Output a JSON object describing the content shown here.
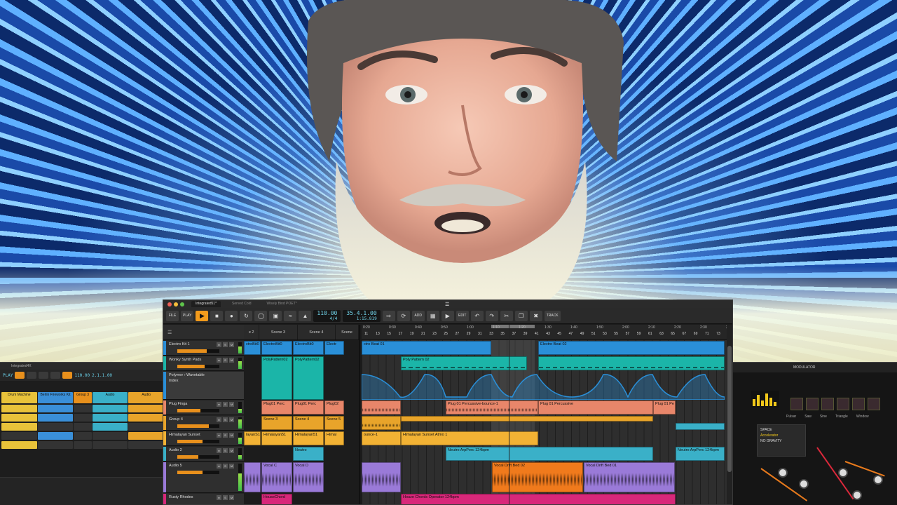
{
  "main_window": {
    "tabs": [
      "Integrated51*",
      "Served Cold",
      "Wisely Bind POET*"
    ],
    "transport": {
      "file_label": "FILE",
      "play_label": "PLAY",
      "tempo": "110.00",
      "time_sig": "4/4",
      "position": "35.4.1.00",
      "time": "1:15.819",
      "add_label": "ADD",
      "edit_label": "EDIT",
      "track_label": "TRACK"
    },
    "scenes": [
      "e 2",
      "Scene 3",
      "Scene 4",
      "Scene"
    ],
    "ruler_times": [
      "0:20",
      "0:30",
      "0:40",
      "0:50",
      "1:00",
      "1:10",
      "1:20",
      "1:30",
      "1:40",
      "1:50",
      "2:00",
      "2:10",
      "2:20",
      "2:30",
      "2:40"
    ],
    "ruler_bars": [
      "11",
      "13",
      "15",
      "17",
      "19",
      "21",
      "23",
      "25",
      "27",
      "29",
      "31",
      "33",
      "35",
      "37",
      "39",
      "41",
      "43",
      "45",
      "47",
      "49",
      "51",
      "53",
      "55",
      "57",
      "59",
      "61",
      "63",
      "65",
      "67",
      "69",
      "71",
      "73"
    ],
    "tracks": [
      {
        "name": "Electro Kit 1",
        "color": "#2a8fd8"
      },
      {
        "name": "Wonky Synth Pads",
        "color": "#1bb5a8"
      },
      {
        "name": "Polymer › Wavetable",
        "sub": "Index",
        "color": "#2a8fd8"
      },
      {
        "name": "Plug Finga",
        "color": "#e8866a"
      },
      {
        "name": "Group 4",
        "color": "#e8a42a"
      },
      {
        "name": "Himalayan Sunset",
        "color": "#f2b234"
      },
      {
        "name": "Audio 2",
        "color": "#3ab0c8"
      },
      {
        "name": "Audio 5",
        "color": "#9a7ad8"
      },
      {
        "name": "Rusty Rhodes",
        "color": "#d8287a"
      }
    ],
    "clip_launcher": {
      "row0": [
        "ctroBit0",
        "ElectroBit0",
        "ElectroBit0",
        "Electr"
      ],
      "row1": [
        "PolyPattern02",
        "PolyPattern02"
      ],
      "row3": [
        "Plug01 Perc",
        "Plug01 Perc",
        "Plug02"
      ],
      "row4": [
        "Scene 3",
        "Scene 4",
        "Scene 5"
      ],
      "row5": [
        "layanS1",
        "Himalayan51",
        "Himalayan51",
        "Himal"
      ],
      "row6": [
        "Neutro"
      ],
      "row7": [
        "Vocal C",
        "Vocal D"
      ],
      "row8": [
        "HouseChord"
      ]
    },
    "arranger_clips": {
      "electro1": "ctro Beat 01",
      "electro2": "Electro Beat 02",
      "poly": "Poly Pattern 02",
      "plug1": "Plug 01 Percussive-bounce-1",
      "plug2": "Plug 01 Percussive",
      "plug3": "Plug 01 Pe",
      "himal1": "ounce-1",
      "himal2": "Himalayan Sunset Atmo 1",
      "neutro1": "Neutro ArpPerc 124bpm",
      "neutro2": "Neutro ArpPerc 124bpm",
      "vocal1": "Vocal Drift Bed 02",
      "vocal2": "Vocal Drift Bed 01",
      "house": "Houze Chords Operator 124bpm"
    }
  },
  "left_window": {
    "tab": "Integrated4X",
    "play_label": "PLAY",
    "tempo": "110.00",
    "time_sig": "4/4",
    "position": "2.1.1.00",
    "time": "0:02.000",
    "columns": [
      {
        "name": "Drum Machine",
        "color": "#e8c23a"
      },
      {
        "name": "Berlin Fireworks Kit",
        "color": "#3a8fd8"
      },
      {
        "name": "Group 3",
        "color": "#e8901c"
      },
      {
        "name": "Audio",
        "color": "#3ab0c8"
      },
      {
        "name": "Audio",
        "color": "#e8a42a"
      }
    ]
  },
  "right_window": {
    "modulator_label": "MODULATOR",
    "space_label": "SPACE",
    "no_gravity": "NO GRAVITY",
    "accelerator": "Accelerator",
    "mod_names": [
      "Probabilities",
      "Pulsar",
      "Saw",
      "Sine",
      "Triangle",
      "Window"
    ]
  }
}
